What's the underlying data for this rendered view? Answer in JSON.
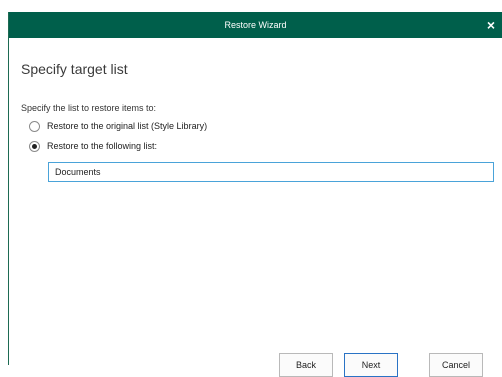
{
  "window": {
    "title": "Restore Wizard",
    "close_glyph": "×"
  },
  "step": {
    "heading": "Specify target list",
    "prompt": "Specify the list to restore items to:"
  },
  "options": [
    {
      "label": "Restore to the original list (Style Library)",
      "checked": false
    },
    {
      "label": "Restore to the following list:",
      "checked": true
    }
  ],
  "target_list": {
    "value": "Documents"
  },
  "buttons": {
    "back": "Back",
    "next": "Next",
    "cancel": "Cancel"
  },
  "colors": {
    "titlebar": "#005f4b",
    "input_focus_border": "#4aa3d9"
  }
}
